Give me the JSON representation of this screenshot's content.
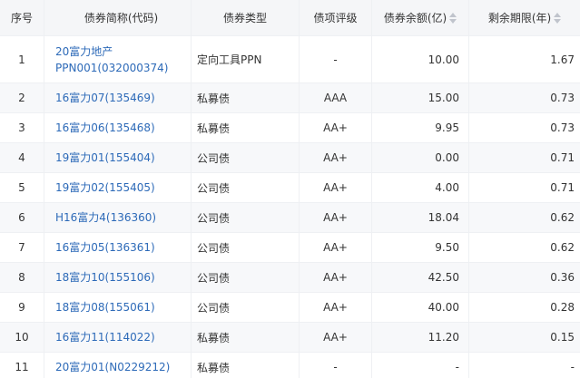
{
  "headers": {
    "index": "序号",
    "name": "债券简称(代码)",
    "type": "债券类型",
    "rating": "债项评级",
    "amount": "债券余额(亿)",
    "term": "剩余期限(年)"
  },
  "rows": [
    {
      "index": "1",
      "name_line1": "20富力地产",
      "name_line2": "PPN001(032000374)",
      "type": "定向工具PPN",
      "rating": "-",
      "amount": "10.00",
      "term": "1.67"
    },
    {
      "index": "2",
      "name_line1": "16富力07(135469)",
      "name_line2": "",
      "type": "私募债",
      "rating": "AAA",
      "amount": "15.00",
      "term": "0.73"
    },
    {
      "index": "3",
      "name_line1": "16富力06(135468)",
      "name_line2": "",
      "type": "私募债",
      "rating": "AA+",
      "amount": "9.95",
      "term": "0.73"
    },
    {
      "index": "4",
      "name_line1": "19富力01(155404)",
      "name_line2": "",
      "type": "公司债",
      "rating": "AA+",
      "amount": "0.00",
      "term": "0.71"
    },
    {
      "index": "5",
      "name_line1": "19富力02(155405)",
      "name_line2": "",
      "type": "公司债",
      "rating": "AA+",
      "amount": "4.00",
      "term": "0.71"
    },
    {
      "index": "6",
      "name_line1": "H16富力4(136360)",
      "name_line2": "",
      "type": "公司债",
      "rating": "AA+",
      "amount": "18.04",
      "term": "0.62"
    },
    {
      "index": "7",
      "name_line1": "16富力05(136361)",
      "name_line2": "",
      "type": "公司债",
      "rating": "AA+",
      "amount": "9.50",
      "term": "0.62"
    },
    {
      "index": "8",
      "name_line1": "18富力10(155106)",
      "name_line2": "",
      "type": "公司债",
      "rating": "AA+",
      "amount": "42.50",
      "term": "0.36"
    },
    {
      "index": "9",
      "name_line1": "18富力08(155061)",
      "name_line2": "",
      "type": "公司债",
      "rating": "AA+",
      "amount": "40.00",
      "term": "0.28"
    },
    {
      "index": "10",
      "name_line1": "16富力11(114022)",
      "name_line2": "",
      "type": "私募债",
      "rating": "AA+",
      "amount": "11.20",
      "term": "0.15"
    },
    {
      "index": "11",
      "name_line1": "20富力01(N0229212)",
      "name_line2": "",
      "type": "私募债",
      "rating": "-",
      "amount": "-",
      "term": "-"
    }
  ],
  "colors": {
    "link": "#2d6ab8",
    "header_bg": "#f5f6f8",
    "alt_row_bg": "#f7f8fa",
    "border": "#eef0f3",
    "sort_icon": "#c0c4cc"
  },
  "icons": {
    "amount_sort": "sort-icon",
    "term_sort": "sort-icon"
  }
}
